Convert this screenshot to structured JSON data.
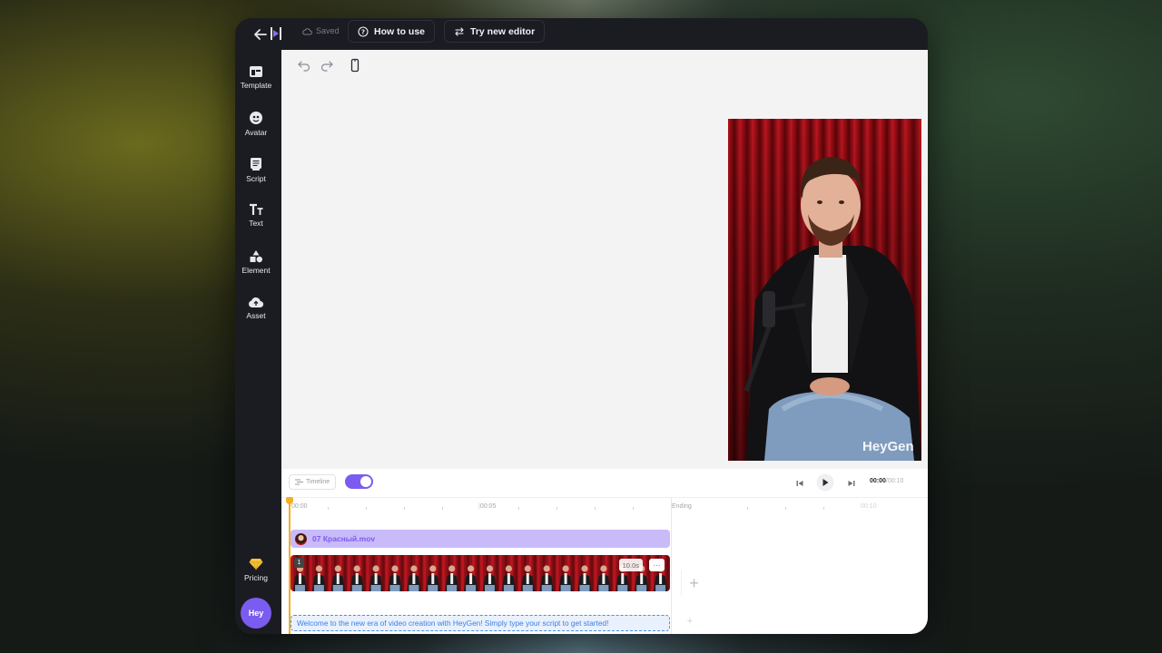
{
  "topbar": {
    "saved_label": "Saved",
    "how_to_use_label": "How to use",
    "try_new_editor_label": "Try new editor"
  },
  "sidebar": {
    "items": [
      {
        "label": "Template",
        "icon": "template-icon"
      },
      {
        "label": "Avatar",
        "icon": "avatar-icon"
      },
      {
        "label": "Script",
        "icon": "script-icon"
      },
      {
        "label": "Text",
        "icon": "text-icon"
      },
      {
        "label": "Element",
        "icon": "element-icon"
      },
      {
        "label": "Asset",
        "icon": "upload-cloud-icon"
      }
    ],
    "pricing_label": "Pricing",
    "avatar_text": "Hey"
  },
  "canvas": {
    "watermark": "HeyGen"
  },
  "timeline": {
    "toggle_label": "Timeline",
    "current_time": "00:00",
    "total_time": "/00:10",
    "ruler": {
      "start": "00:00",
      "mid": "00:05",
      "ending": "Ending",
      "end": "00:10"
    },
    "audio_track_name": "07 Красный.mov",
    "scene_number": "1",
    "scene_duration": "10.0s",
    "more": "···",
    "script_text": "Welcome to the new era of video creation with HeyGen! Simply type your script to get started!"
  },
  "colors": {
    "accent": "#7b5cf0",
    "script_blue": "#3d7fe0",
    "playhead": "#f2b01e",
    "pricing_gem": "#f5c33b"
  }
}
